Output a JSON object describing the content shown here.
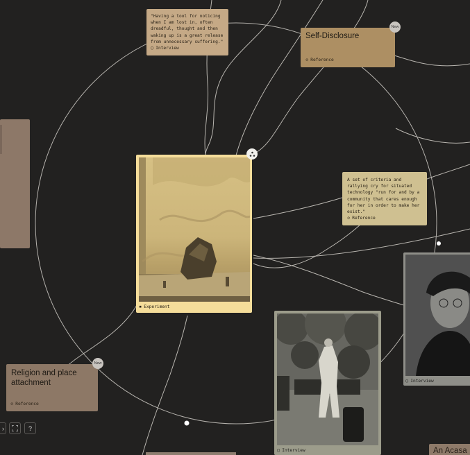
{
  "cards": {
    "quote_interview": {
      "text": "\"Having a tool for noticing\nwhen I am lost in, often\ndreadful, thought and then\nwaking up is a great release\nfrom unnecessary suffering.\"",
      "tag": "Interview",
      "tag_icon": "circle-icon"
    },
    "self_disclosure": {
      "title": "Self-Disclosure",
      "tag": "Reference",
      "tag_icon": "diamond-icon",
      "badge": "New"
    },
    "criteria": {
      "text": "A set of criteria and\nrallying cry for situated\ntechnology \"run for and by a\ncommunity that cares enough\nfor her in order to make her\nexist.\"",
      "tag": "Reference",
      "tag_icon": "diamond-icon"
    },
    "experiment": {
      "tag": "Experiment",
      "tag_icon": "square-icon"
    },
    "portrait_interview": {
      "tag": "Interview",
      "tag_icon": "circle-icon"
    },
    "park_interview": {
      "tag": "Interview",
      "tag_icon": "circle-icon"
    },
    "religion": {
      "title": "Religion and place\nattachment",
      "tag": "Reference",
      "tag_icon": "diamond-icon",
      "badge": "New"
    },
    "partial_bottom_right": {
      "title": "An Acasa"
    }
  },
  "controls": {
    "fullscreen_icon": "expand-icon",
    "help_label": "?"
  },
  "colors": {
    "background": "#222120",
    "card_tan": "#c9b78e",
    "card_brown": "#a8865d",
    "card_selected": "#f5dd9a",
    "card_muted": "#8d7868",
    "lines": "#bdbab4"
  }
}
